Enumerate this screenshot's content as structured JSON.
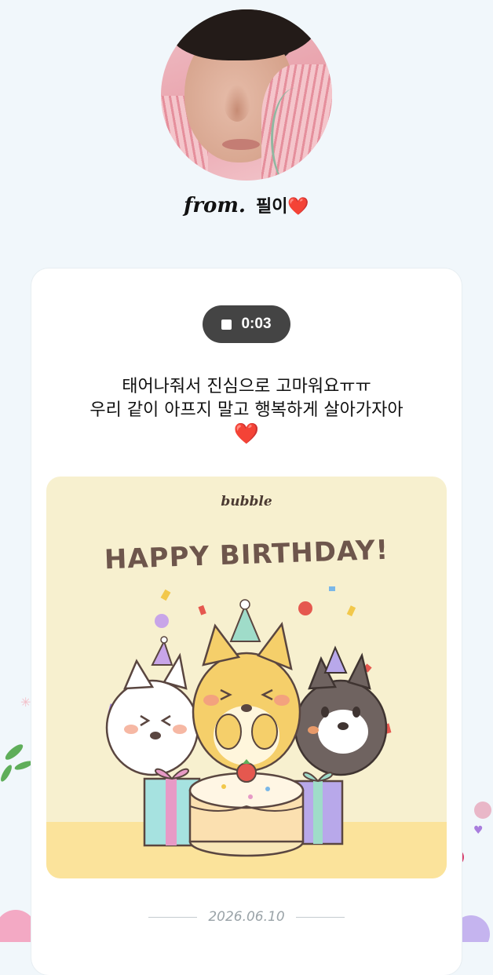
{
  "sender": {
    "prefix": "from.",
    "name": "필이❤️"
  },
  "audio": {
    "time": "0:03"
  },
  "message": {
    "line1": "태어나줘서 진심으로 고마워요ㅠㅠ",
    "line2": "우리 같이 아프지 말고 행복하게 살아가자아",
    "heart": "❤️"
  },
  "card_image": {
    "brand": "bubble",
    "title": "HAPPY BIRTHDAY!"
  },
  "footer": {
    "date": "2026.06.10"
  },
  "colors": {
    "background": "#f1f7fb",
    "card": "#ffffff",
    "audio_pill": "#444444",
    "birthday_bg": "#f7f0cf"
  }
}
